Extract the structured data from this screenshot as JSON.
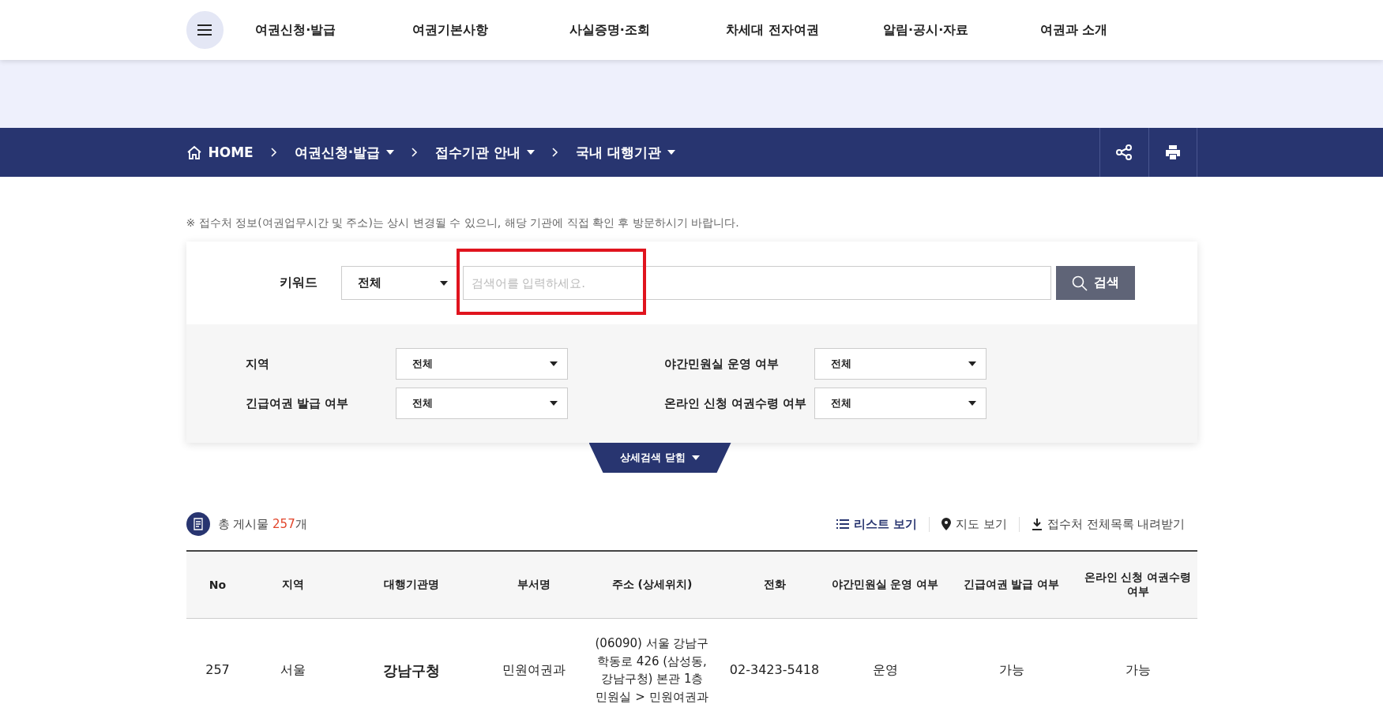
{
  "nav": {
    "items": [
      "여권신청·발급",
      "여권기본사항",
      "사실증명·조회",
      "차세대 전자여권",
      "알림·공시·자료",
      "여권과 소개"
    ]
  },
  "breadcrumb": [
    {
      "label": "HOME",
      "kind": "home"
    },
    {
      "label": "여권신청·발급",
      "kind": "menu"
    },
    {
      "label": "접수기관 안내",
      "kind": "menu"
    },
    {
      "label": "국내 대행기관",
      "kind": "menu"
    }
  ],
  "notice": "※ 접수처 정보(여권업무시간 및 주소)는 상시 변경될 수 있으니, 해당 기관에 직접 확인 후 방문하시기 바랍니다.",
  "search": {
    "label": "키워드",
    "scope": "전체",
    "placeholder": "검색어를 입력하세요.",
    "button": "검색"
  },
  "filters": [
    {
      "label": "지역",
      "value": "전체"
    },
    {
      "label": "야간민원실 운영 여부",
      "value": "전체"
    },
    {
      "label": "긴급여권 발급 여부",
      "value": "전체"
    },
    {
      "label": "온라인 신청 여권수령 여부",
      "value": "전체"
    }
  ],
  "detail_toggle": "상세검색 닫힘",
  "count": {
    "prefix": "총 게시물 ",
    "number": "257",
    "suffix": "개"
  },
  "views": [
    {
      "label": "리스트 보기",
      "kind": "list",
      "selected": true
    },
    {
      "label": "지도 보기",
      "kind": "map",
      "selected": false
    },
    {
      "label": "접수처 전체목록 내려받기",
      "kind": "download",
      "selected": false
    }
  ],
  "table": {
    "columns": [
      "No",
      "지역",
      "대행기관명",
      "부서명",
      "주소 (상세위치)",
      "전화",
      "야간민원실 운영 여부",
      "긴급여권 발급 여부",
      "온라인 신청 여권수령 여부"
    ],
    "rows": [
      [
        "257",
        "서울",
        "강남구청",
        "민원여권과",
        "(06090) 서울 강남구 학동로 426 (삼성동, 강남구청) 본관 1층 민원실 > 민원여권과",
        "02-3423-5418",
        "운영",
        "가능",
        "가능"
      ]
    ]
  }
}
